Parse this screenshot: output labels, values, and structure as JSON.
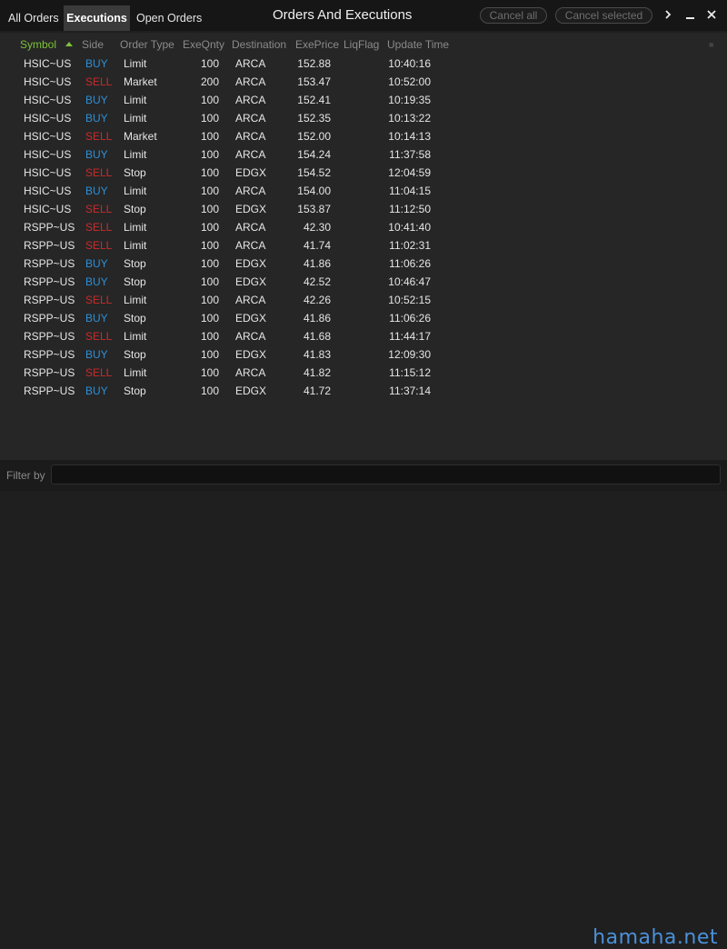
{
  "tabs": [
    {
      "label": "All Orders",
      "active": false
    },
    {
      "label": "Executions",
      "active": true
    },
    {
      "label": "Open Orders",
      "active": false
    }
  ],
  "window_title": "Orders And Executions",
  "toolbar": {
    "cancel_all": "Cancel all",
    "cancel_selected": "Cancel selected",
    "expand_icon": "chevron-right-icon",
    "minimize_icon": "minimize-icon",
    "close_icon": "close-icon"
  },
  "columns": [
    "Symbol",
    "Side",
    "Order Type",
    "ExeQnty",
    "Destination",
    "ExePrice",
    "LiqFlag",
    "Update Time"
  ],
  "sort": {
    "column": "Symbol",
    "direction": "ascending"
  },
  "rows": [
    {
      "symbol": "HSIC~US",
      "side": "BUY",
      "type": "Limit",
      "qty": "100",
      "dest": "ARCA",
      "price": "152.88",
      "liq": "",
      "time": "10:40:16"
    },
    {
      "symbol": "HSIC~US",
      "side": "SELL",
      "type": "Market",
      "qty": "200",
      "dest": "ARCA",
      "price": "153.47",
      "liq": "",
      "time": "10:52:00"
    },
    {
      "symbol": "HSIC~US",
      "side": "BUY",
      "type": "Limit",
      "qty": "100",
      "dest": "ARCA",
      "price": "152.41",
      "liq": "",
      "time": "10:19:35"
    },
    {
      "symbol": "HSIC~US",
      "side": "BUY",
      "type": "Limit",
      "qty": "100",
      "dest": "ARCA",
      "price": "152.35",
      "liq": "",
      "time": "10:13:22"
    },
    {
      "symbol": "HSIC~US",
      "side": "SELL",
      "type": "Market",
      "qty": "100",
      "dest": "ARCA",
      "price": "152.00",
      "liq": "",
      "time": "10:14:13"
    },
    {
      "symbol": "HSIC~US",
      "side": "BUY",
      "type": "Limit",
      "qty": "100",
      "dest": "ARCA",
      "price": "154.24",
      "liq": "",
      "time": "11:37:58"
    },
    {
      "symbol": "HSIC~US",
      "side": "SELL",
      "type": "Stop",
      "qty": "100",
      "dest": "EDGX",
      "price": "154.52",
      "liq": "",
      "time": "12:04:59"
    },
    {
      "symbol": "HSIC~US",
      "side": "BUY",
      "type": "Limit",
      "qty": "100",
      "dest": "ARCA",
      "price": "154.00",
      "liq": "",
      "time": "11:04:15"
    },
    {
      "symbol": "HSIC~US",
      "side": "SELL",
      "type": "Stop",
      "qty": "100",
      "dest": "EDGX",
      "price": "153.87",
      "liq": "",
      "time": "11:12:50"
    },
    {
      "symbol": "RSPP~US",
      "side": "SELL",
      "type": "Limit",
      "qty": "100",
      "dest": "ARCA",
      "price": "42.30",
      "liq": "",
      "time": "10:41:40"
    },
    {
      "symbol": "RSPP~US",
      "side": "SELL",
      "type": "Limit",
      "qty": "100",
      "dest": "ARCA",
      "price": "41.74",
      "liq": "",
      "time": "11:02:31"
    },
    {
      "symbol": "RSPP~US",
      "side": "BUY",
      "type": "Stop",
      "qty": "100",
      "dest": "EDGX",
      "price": "41.86",
      "liq": "",
      "time": "11:06:26"
    },
    {
      "symbol": "RSPP~US",
      "side": "BUY",
      "type": "Stop",
      "qty": "100",
      "dest": "EDGX",
      "price": "42.52",
      "liq": "",
      "time": "10:46:47"
    },
    {
      "symbol": "RSPP~US",
      "side": "SELL",
      "type": "Limit",
      "qty": "100",
      "dest": "ARCA",
      "price": "42.26",
      "liq": "",
      "time": "10:52:15"
    },
    {
      "symbol": "RSPP~US",
      "side": "BUY",
      "type": "Stop",
      "qty": "100",
      "dest": "EDGX",
      "price": "41.86",
      "liq": "",
      "time": "11:06:26"
    },
    {
      "symbol": "RSPP~US",
      "side": "SELL",
      "type": "Limit",
      "qty": "100",
      "dest": "ARCA",
      "price": "41.68",
      "liq": "",
      "time": "11:44:17"
    },
    {
      "symbol": "RSPP~US",
      "side": "BUY",
      "type": "Stop",
      "qty": "100",
      "dest": "EDGX",
      "price": "41.83",
      "liq": "",
      "time": "12:09:30"
    },
    {
      "symbol": "RSPP~US",
      "side": "SELL",
      "type": "Limit",
      "qty": "100",
      "dest": "ARCA",
      "price": "41.82",
      "liq": "",
      "time": "11:15:12"
    },
    {
      "symbol": "RSPP~US",
      "side": "BUY",
      "type": "Stop",
      "qty": "100",
      "dest": "EDGX",
      "price": "41.72",
      "liq": "",
      "time": "11:37:14"
    }
  ],
  "side_colors": {
    "BUY": "#2e8fd6",
    "SELL": "#cc2a2a"
  },
  "filter": {
    "label": "Filter by",
    "value": "",
    "placeholder": ""
  },
  "watermark": "hamaha.net"
}
